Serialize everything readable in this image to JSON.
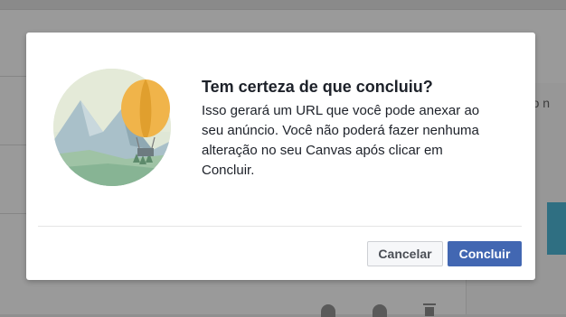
{
  "background": {
    "right_text": "ação n"
  },
  "dialog": {
    "title": "Tem certeza de que concluiu?",
    "message": "Isso gerará um URL que você pode anexar ao seu anúncio. Você não poderá fazer nenhuma alteração no seu Canvas após clicar em Concluir.",
    "illustration": "hot-air-balloon-mountains",
    "buttons": {
      "cancel": "Cancelar",
      "confirm": "Concluir"
    }
  },
  "colors": {
    "primary": "#4267b2",
    "overlay": "#9a9a9a",
    "balloon": "#f0b44a",
    "circle": "#cfe1e3"
  }
}
